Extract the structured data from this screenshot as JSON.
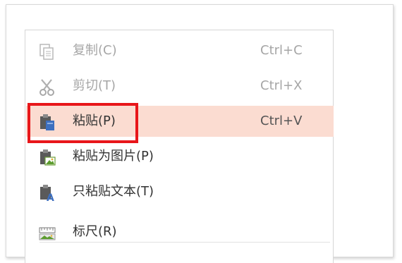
{
  "colors": {
    "hover_background": "#fbdcd1",
    "highlight_border": "#e8161a",
    "disabled_text": "#a6a6a6",
    "normal_text": "#333333"
  },
  "menu": {
    "items": [
      {
        "label": "复制(C)",
        "shortcut": "Ctrl+C",
        "icon": "copy-icon",
        "enabled": false
      },
      {
        "label": "剪切(T)",
        "shortcut": "Ctrl+X",
        "icon": "scissors-icon",
        "enabled": false
      },
      {
        "label": "粘贴(P)",
        "shortcut": "Ctrl+V",
        "icon": "paste-icon",
        "enabled": true,
        "hovered": true
      },
      {
        "label": "粘贴为图片(P)",
        "shortcut": "",
        "icon": "paste-as-image-icon",
        "enabled": true
      },
      {
        "label": "只粘贴文本(T)",
        "shortcut": "",
        "icon": "paste-text-only-icon",
        "enabled": true
      },
      {
        "label": "标尺(R)",
        "shortcut": "",
        "icon": "ruler-icon",
        "enabled": true
      }
    ]
  }
}
